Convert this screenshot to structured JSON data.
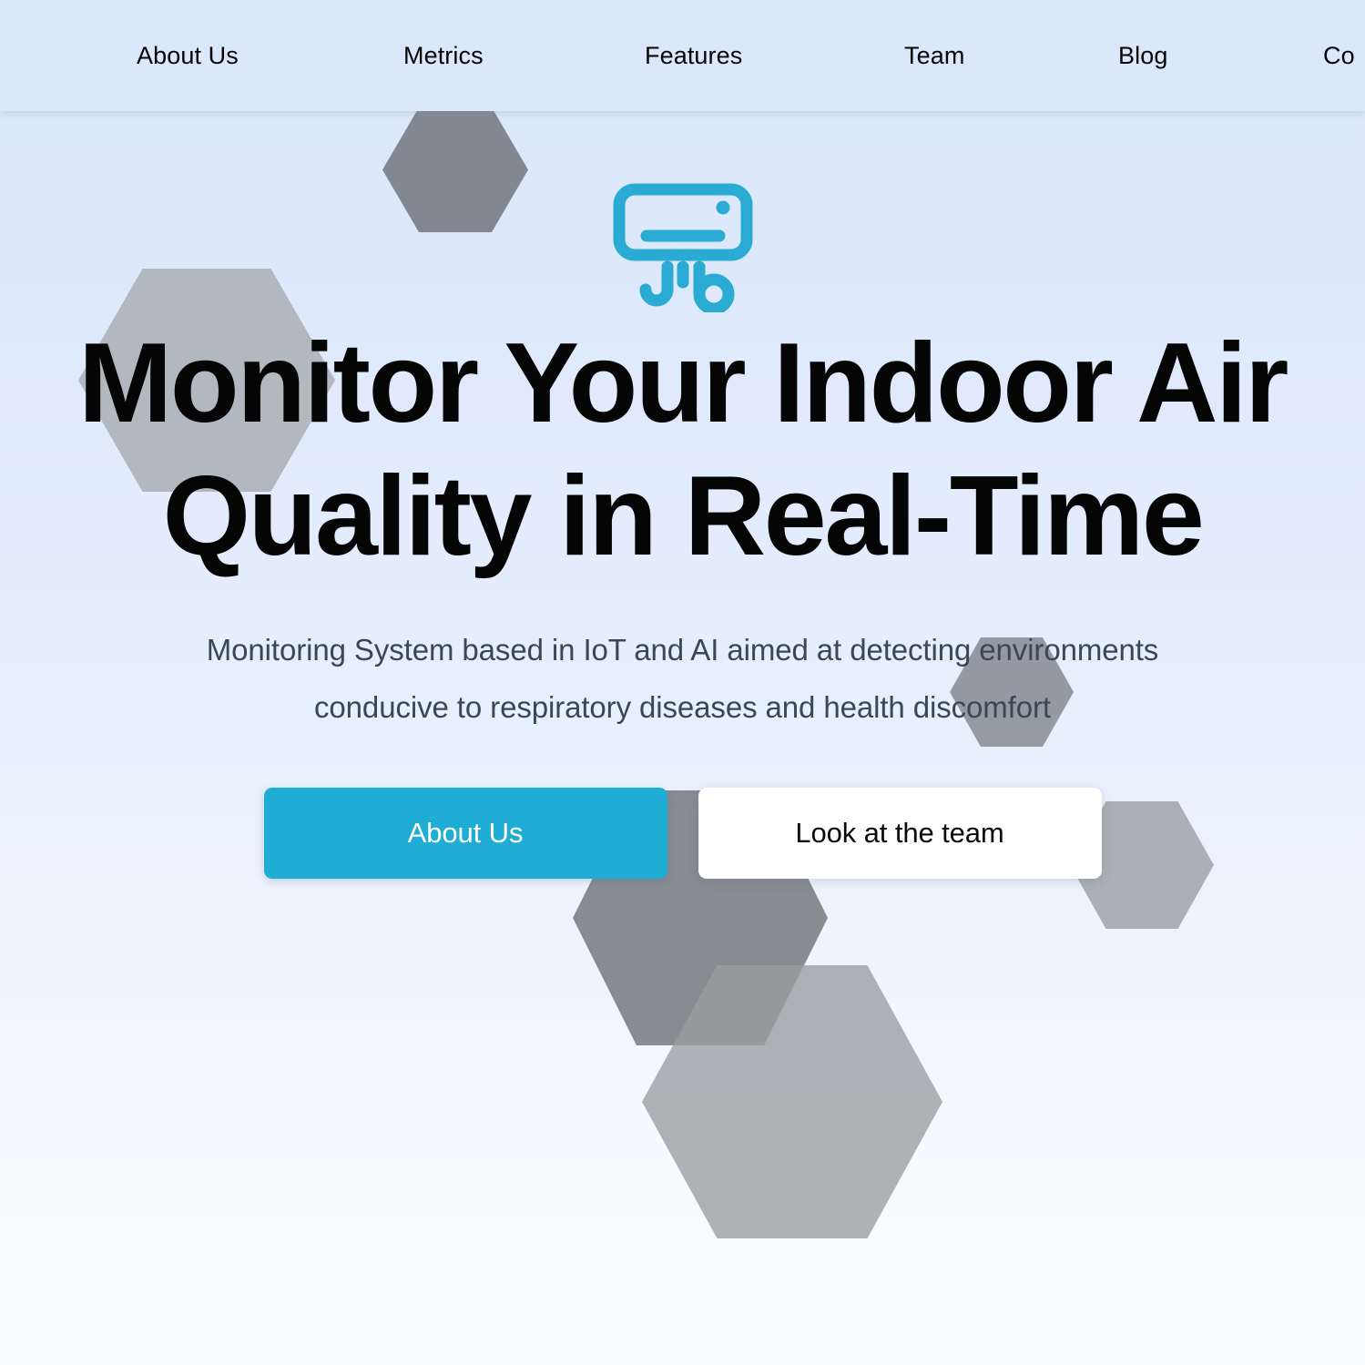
{
  "nav": {
    "items": [
      {
        "label": "About Us"
      },
      {
        "label": "Metrics"
      },
      {
        "label": "Features"
      },
      {
        "label": "Team"
      },
      {
        "label": "Blog"
      },
      {
        "label": "Co"
      }
    ]
  },
  "hero": {
    "logo_icon": "air-conditioner-icon",
    "title_line_1": "Monitor Your Indoor Air",
    "title_line_2": "Quality in Real-Time",
    "subtitle_line_1": "Monitoring System based in IoT and AI aimed at detecting environments",
    "subtitle_line_2": "conducive to respiratory diseases and health discomfort",
    "primary_button_label": "About Us",
    "secondary_button_label": "Look at the team"
  },
  "colors": {
    "accent": "#20ADD5",
    "nav_background": "#DBE7FB",
    "page_background_top": "#DCE8FB",
    "page_background_bottom": "#FBFCFE",
    "heading_text": "#050505",
    "subtitle_text": "#3B4754",
    "hexagon_light": "#B0B6BD",
    "hexagon_mid": "#9A9DA0",
    "hexagon_dark": "#6E7276"
  }
}
